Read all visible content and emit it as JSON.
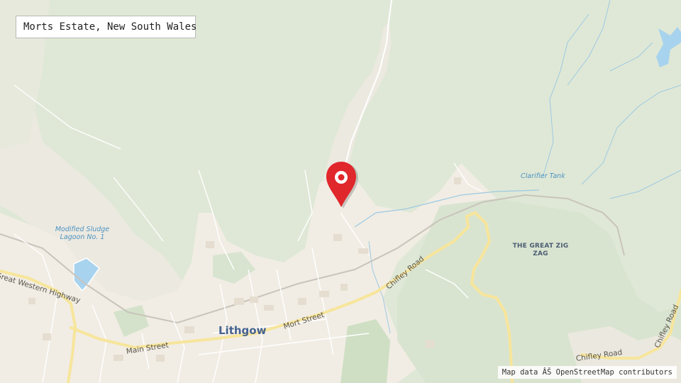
{
  "search": {
    "value": "Morts Estate, New South Wales"
  },
  "attribution": "Map data ÂŠ OpenStreetMap contributors",
  "labels": {
    "town": "Lithgow",
    "water": [
      {
        "id": "sludge",
        "lines": [
          "Modified Sludge",
          "Lagoon No. 1"
        ]
      },
      {
        "id": "clarifier",
        "lines": [
          "Clarifier Tank"
        ]
      }
    ],
    "area": [
      "THE GREAT ZIG",
      "ZAG"
    ],
    "roads": {
      "great_western": "Great Western Highway",
      "main": "Main Street",
      "mort": "Mort Street",
      "chifley_center": "Chifley Road",
      "chifley_bottom": "Chifley Road",
      "chifley_right": "Chifley Road"
    }
  },
  "marker": {
    "icon": "map-pin-icon",
    "color": "#e0272b"
  },
  "colors": {
    "forest": "#dfe8d6",
    "urban": "#f1ede4",
    "water": "#a8d3ee",
    "major_road": "#f7e59b",
    "stream": "#9dc9e3"
  }
}
